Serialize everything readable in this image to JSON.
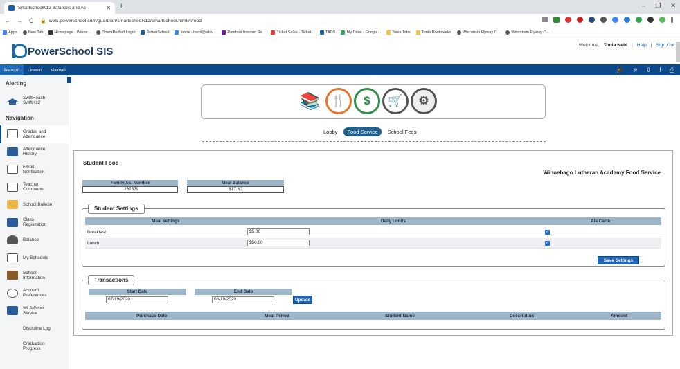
{
  "browser": {
    "tab_title": "SmartschoolK12 Balances and Ac",
    "url": "wels.powerschool.com/guardian/smartschoolk12/smartschool.html#!/food",
    "bookmarks": [
      "Apps",
      "New Tab",
      "Homepage - Winne...",
      "DonorPerfect Login",
      "PowerSchool",
      "Inbox - tnebl@wlav...",
      "Pandora Internet Ra...",
      "Ticket Sales - Ticket...",
      "TADS",
      "My Drive - Google...",
      "Tonia Tabs",
      "Tonia Bookmarks",
      "Wisconsin Flyway C...",
      "Wisconsin Flyway C..."
    ]
  },
  "header": {
    "logo_text": "PowerSchool SIS",
    "welcome_label": "Welcome,",
    "user_name": "Tonia Nebl",
    "help": "Help",
    "sign_out": "Sign Out"
  },
  "school_tabs": [
    "Benson",
    "Lincoln",
    "Maxwell"
  ],
  "sidebar": {
    "alerting_heading": "Alerting",
    "alerting_item": "SwiftReach SwiftK12",
    "navigation_heading": "Navigation",
    "items": [
      {
        "label": "Grades and Attendance"
      },
      {
        "label": "Attendance History"
      },
      {
        "label": "Email Notification"
      },
      {
        "label": "Teacher Comments"
      },
      {
        "label": "School Bulletin"
      },
      {
        "label": "Class Registration"
      },
      {
        "label": "Balance"
      },
      {
        "label": "My Schedule"
      },
      {
        "label": "School Information"
      },
      {
        "label": "Account Preferences"
      },
      {
        "label": "WLA Food Service"
      },
      {
        "label": "Discipline Log"
      },
      {
        "label": "Graduation Progress"
      }
    ]
  },
  "subtabs": [
    "Lobby",
    "Food Service",
    "School Fees"
  ],
  "food": {
    "section_title": "Student Food",
    "school_name": "Winnebago Lutheran Academy Food Service",
    "family_acc_label": "Family Ac. Number",
    "family_acc_value": "1262879",
    "meal_balance_label": "Meal Balance",
    "meal_balance_value": "$17.60"
  },
  "settings": {
    "legend": "Student Settings",
    "columns": [
      "Meal settings",
      "Daily Limits",
      "Ala Carte"
    ],
    "rows": [
      {
        "meal": "Breakfast",
        "limit": "$5.00"
      },
      {
        "meal": "Lunch",
        "limit": "$50.00"
      }
    ],
    "save_button": "Save Settings"
  },
  "transactions": {
    "legend": "Transactions",
    "start_label": "Start Date",
    "start_value": "07/19/2020",
    "end_label": "End Date",
    "end_value": "08/19/2020",
    "update_button": "Update",
    "columns": [
      "Purchase Date",
      "Meal Period",
      "Student Name",
      "Description",
      "Amount"
    ]
  }
}
